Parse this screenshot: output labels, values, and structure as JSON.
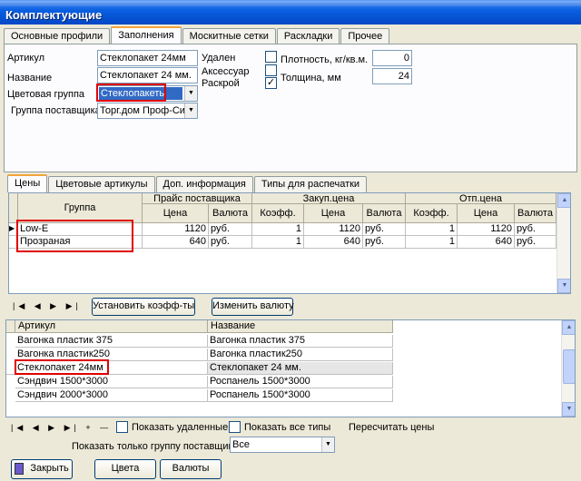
{
  "window": {
    "title": "Комплектующие"
  },
  "tabs": [
    "Основные профили",
    "Заполнения",
    "Москитные сетки",
    "Раскладки",
    "Прочее"
  ],
  "form": {
    "article_label": "Артикул",
    "article_value": "Стеклопакет 24мм",
    "name_label": "Название",
    "name_value": "Стеклопакет 24 мм.",
    "color_group_label": "Цветовая группа",
    "color_group_value": "Стеклопакеты",
    "supplier_group_label": "Группа поставщика",
    "supplier_group_value": "Торг.дом Проф-Сити",
    "deleted_label": "Удален",
    "accessory_label": "Аксессуар",
    "cutting_label": "Раскрой",
    "density_label": "Плотность, кг/кв.м.",
    "density_value": "0",
    "thickness_label": "Толщина, мм",
    "thickness_value": "24",
    "check_mark": "✓"
  },
  "subtabs": [
    "Цены",
    "Цветовые артикулы",
    "Доп. информация",
    "Типы для распечатки"
  ],
  "price_grid": {
    "group_header": "Группа",
    "price_list_header": "Прайс поставщика",
    "purchase_header": "Закуп.цена",
    "sale_header": "Отп.цена",
    "sub_headers": [
      "Цена",
      "Валюта",
      "Коэфф.",
      "Цена",
      "Валюта",
      "Коэфф.",
      "Цена",
      "Валюта"
    ],
    "rows": [
      [
        "Low-E",
        "1120",
        "руб.",
        "1",
        "1120",
        "руб.",
        "1",
        "1120",
        "руб."
      ],
      [
        "Прозраная",
        "640",
        "руб.",
        "1",
        "640",
        "руб.",
        "1",
        "640",
        "руб."
      ]
    ],
    "row_marker": "▶"
  },
  "price_toolbar": {
    "nav": "|◀ ◀ ▶ ▶|",
    "set_coeff_label": "Установить коэфф-ты",
    "change_currency_label": "Изменить валюту"
  },
  "items_grid": {
    "headers": [
      "Артикул",
      "Название"
    ],
    "rows": [
      [
        "Вагонка пластик 375",
        "Вагонка пластик 375"
      ],
      [
        "Вагонка пластик250",
        "Вагонка пластик250"
      ],
      [
        "Стеклопакет 24мм",
        "Стеклопакет 24 мм."
      ],
      [
        "Сэндвич 1500*3000",
        "Роспанель 1500*3000"
      ],
      [
        "Сэндвич 2000*3000",
        "Роспанель 1500*3000"
      ]
    ]
  },
  "bottom_toolbar": {
    "nav": "|◀ ◀ ▶ ▶| + —",
    "show_deleted_label": "Показать удаленные",
    "show_all_types_label": "Показать все типы",
    "recalc_label": "Пересчитать цены",
    "supplier_filter_label": "Показать только группу поставщика",
    "supplier_filter_value": "Все"
  },
  "footer": {
    "close_label": "Закрыть",
    "colors_label": "Цвета",
    "currencies_label": "Валюты"
  }
}
